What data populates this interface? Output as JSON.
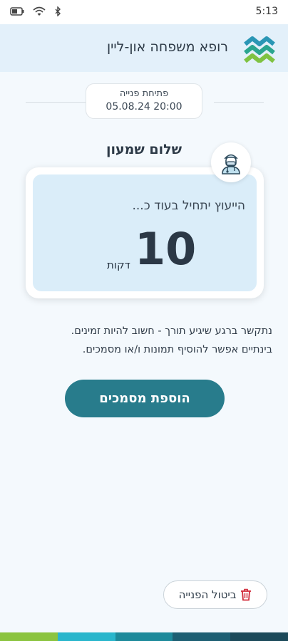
{
  "status_bar": {
    "time": "5:13"
  },
  "header": {
    "title": "רופא משפחה און-ליין",
    "logo": "wave-logo"
  },
  "request": {
    "label": "פתיחת פנייה",
    "date": "05.08.24 20:00"
  },
  "greeting": "שלום שמעון",
  "wait_card": {
    "heading": "הייעוץ יתחיל בעוד כ...",
    "minutes": "10",
    "unit": "דקות",
    "avatar_icon": "doctor-icon"
  },
  "info": {
    "line1": "נתקשר ברגע שיגיע תורך - חשוב להיות זמינים.",
    "line2": "בינתיים אפשר להוסיף תמונות ו/או מסמכים."
  },
  "actions": {
    "add_documents_label": "הוספת מסמכים",
    "cancel_request_label": "ביטול הפנייה",
    "cancel_icon": "trash-icon"
  },
  "colors": {
    "accent": "#287c8c",
    "header_bg": "#e3f0fa",
    "card_bg": "#daedf9",
    "cancel_icon": "#d12b3a",
    "bottom_bar": [
      "#8bc43f",
      "#29b6cc",
      "#1d8a9b",
      "#1d5f73",
      "#1c4a5a"
    ]
  }
}
